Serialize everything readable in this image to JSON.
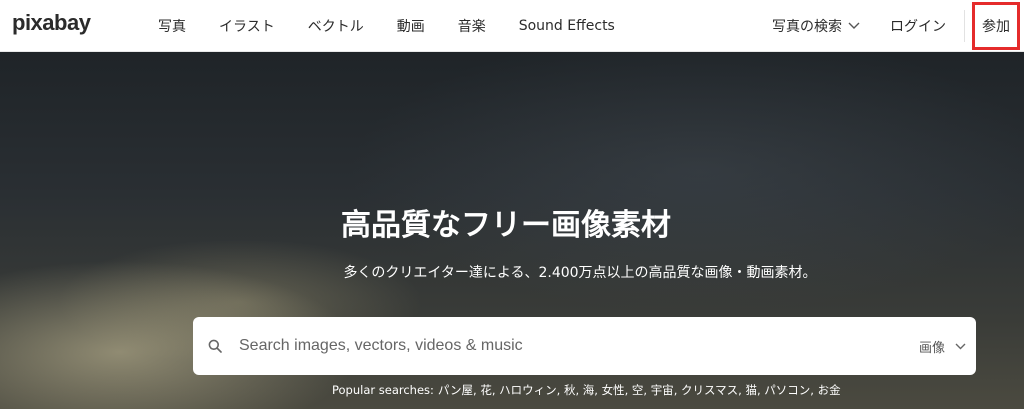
{
  "brand": {
    "logo_text": "pixabay"
  },
  "nav": {
    "items": [
      "写真",
      "イラスト",
      "ベクトル",
      "動画",
      "音楽",
      "Sound Effects"
    ]
  },
  "header_right": {
    "search_type_label": "写真の検索",
    "login_label": "ログイン",
    "join_label": "参加"
  },
  "hero": {
    "title": "高品質なフリー画像素材",
    "subtitle": "多くのクリエイター達による、2.400万点以上の高品質な画像・動画素材。"
  },
  "search": {
    "placeholder": "Search images, vectors, videos & music",
    "value": "",
    "scope_label": "画像"
  },
  "popular": {
    "label": "Popular searches:",
    "terms": [
      "パン屋",
      "花",
      "ハロウィン",
      "秋",
      "海",
      "女性",
      "空",
      "宇宙",
      "クリスマス",
      "猫",
      "パソコン",
      "お金"
    ]
  },
  "colors": {
    "highlight_border": "#e52b2b",
    "text_dark": "#2b2b2b"
  },
  "icons": {
    "search": "search-icon",
    "chevron": "chevron-down-icon"
  }
}
